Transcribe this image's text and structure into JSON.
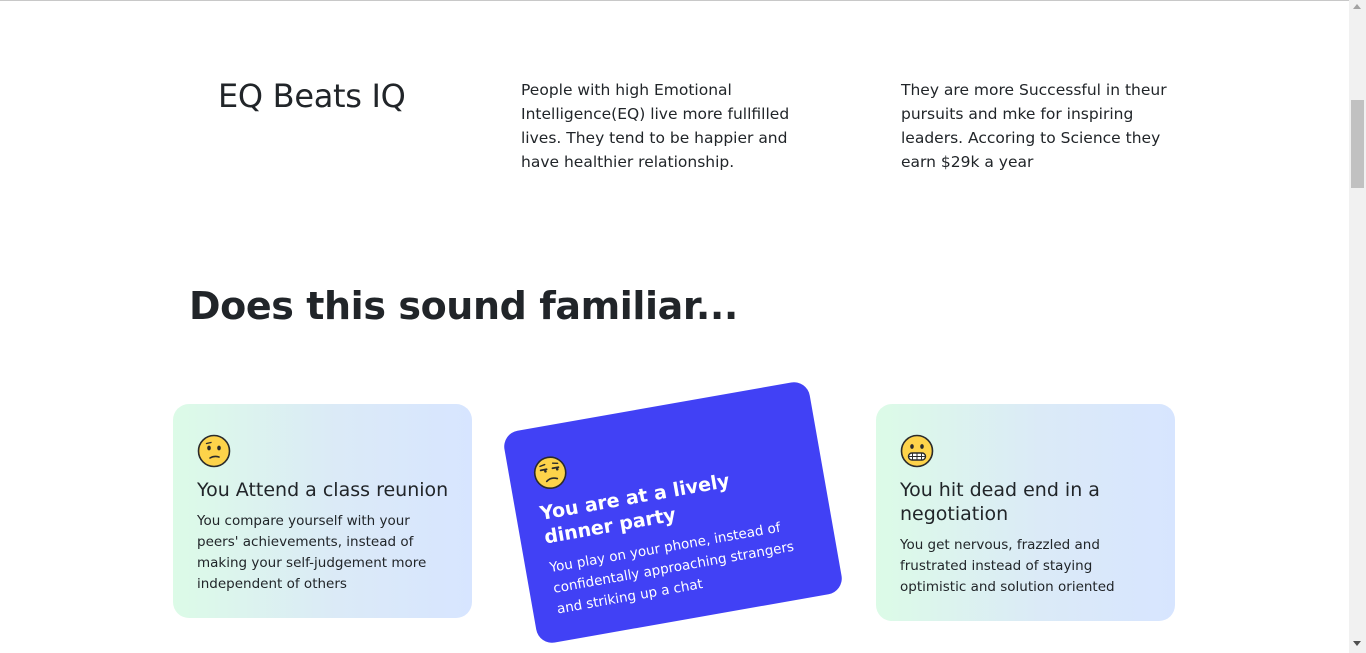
{
  "eq": {
    "title": "EQ Beats IQ",
    "col1": "People with high Emotional Intelligence(EQ) live more fullfilled lives. They tend to be happier and have healthier relationship.",
    "col2": "They are more Successful in theur pursuits and mke for inspiring leaders. Accoring to Science they earn $29k a year"
  },
  "familiar": {
    "heading": "Does this sound familiar...",
    "cards": [
      {
        "icon": "confused-face-icon",
        "title": "You Attend a class reunion",
        "text": "You compare yourself with your peers' achievements, instead of making your self-judgement more independent of others"
      },
      {
        "icon": "unamused-face-icon",
        "title": "You are at a lively dinner party",
        "text": "You play on your phone, instead of confidentally approaching strangers and striking up a chat"
      },
      {
        "icon": "grimacing-face-icon",
        "title": "You hit dead end in a negotiation",
        "text": "You get nervous, frazzled and frustrated instead of staying optimistic and solution oriented"
      }
    ]
  },
  "colors": {
    "highlight_card": "#4141f5",
    "text": "#212529"
  }
}
